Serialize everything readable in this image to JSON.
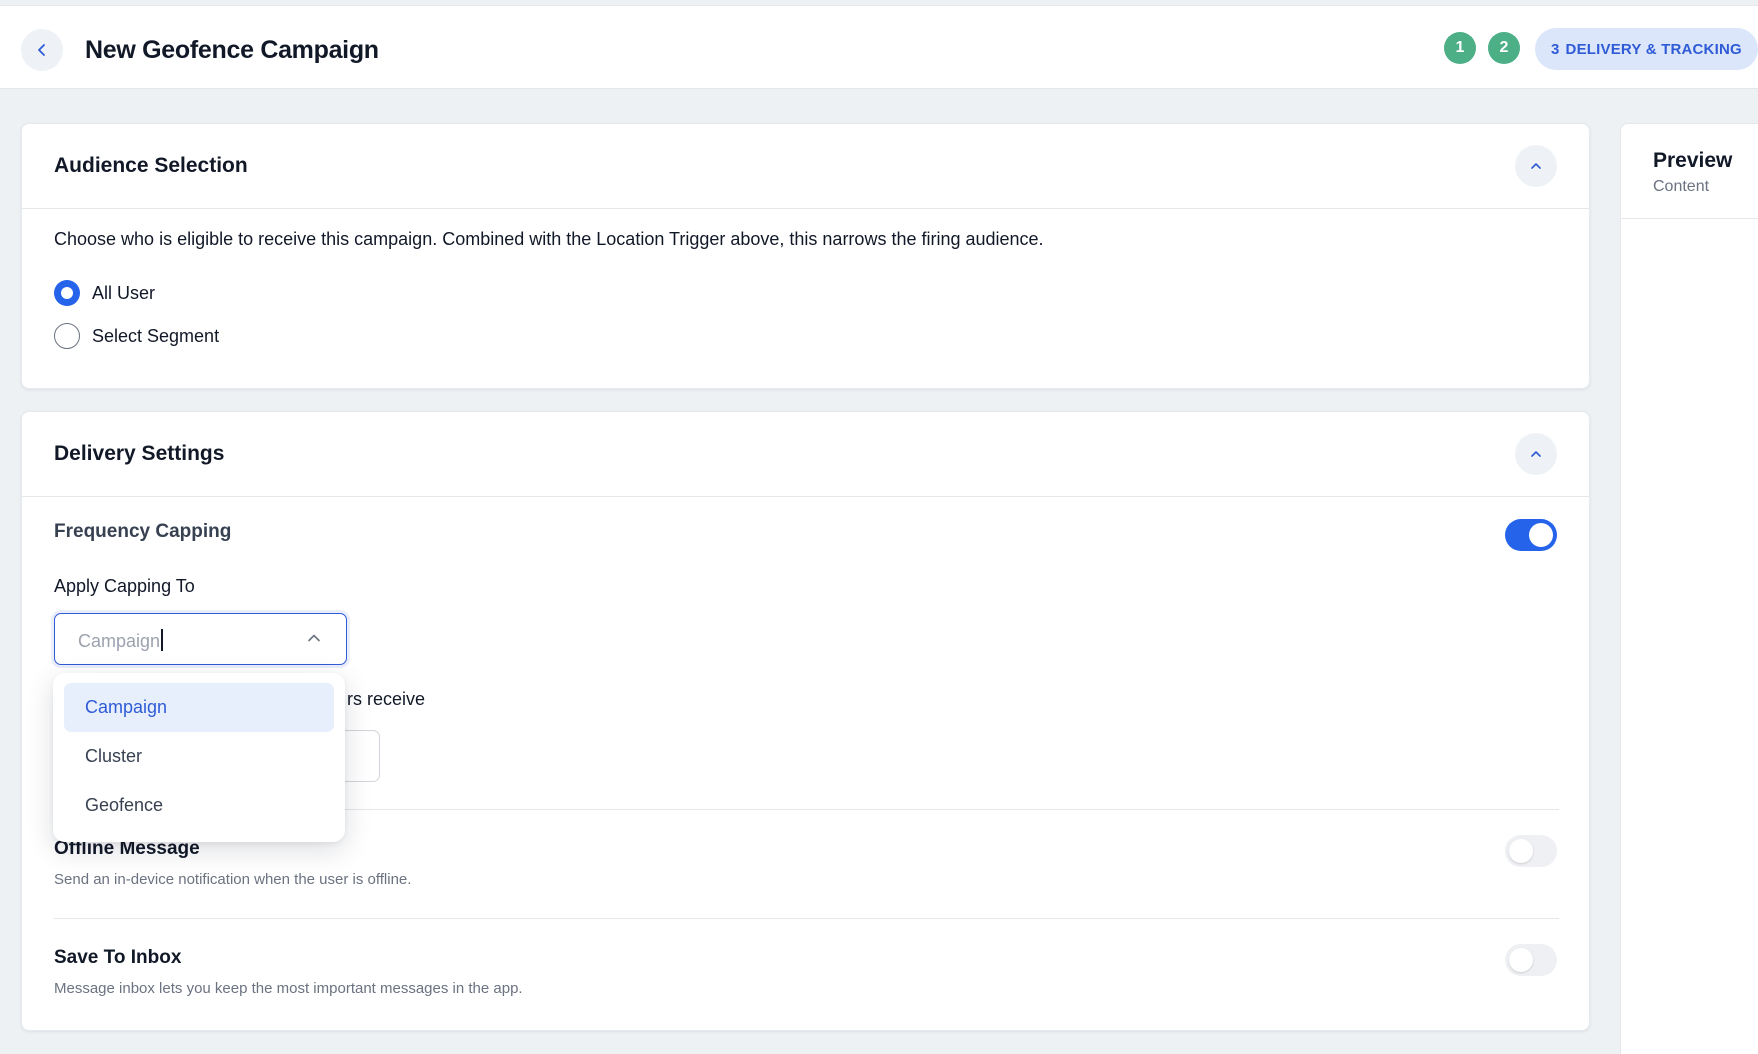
{
  "header": {
    "title": "New Geofence Campaign",
    "steps": [
      {
        "number": "1"
      },
      {
        "number": "2"
      },
      {
        "number": "3",
        "label": "DELIVERY & TRACKING"
      }
    ]
  },
  "audience": {
    "title": "Audience Selection",
    "description": "Choose who is eligible to receive this campaign. Combined with the Location Trigger above, this narrows the firing audience.",
    "options": [
      {
        "label": "All User",
        "selected": true
      },
      {
        "label": "Select Segment",
        "selected": false
      }
    ]
  },
  "delivery": {
    "title": "Delivery Settings",
    "frequency_capping": {
      "label": "Frequency Capping",
      "enabled": true,
      "apply_label": "Apply Capping To",
      "select_value": "Campaign",
      "options": [
        "Campaign",
        "Cluster",
        "Geofence"
      ],
      "partial_text": "rs receive"
    },
    "offline_message": {
      "label": "Offline Message",
      "hint": "Send an in-device notification when the user is offline.",
      "enabled": false
    },
    "save_to_inbox": {
      "label": "Save To Inbox",
      "hint": "Message inbox lets you keep the most important messages in the app.",
      "enabled": false
    }
  },
  "preview": {
    "title": "Preview",
    "subtitle": "Content"
  },
  "colors": {
    "accent": "#2563eb",
    "step_done": "#4caf85",
    "step_active_bg": "#dbe6fb"
  }
}
